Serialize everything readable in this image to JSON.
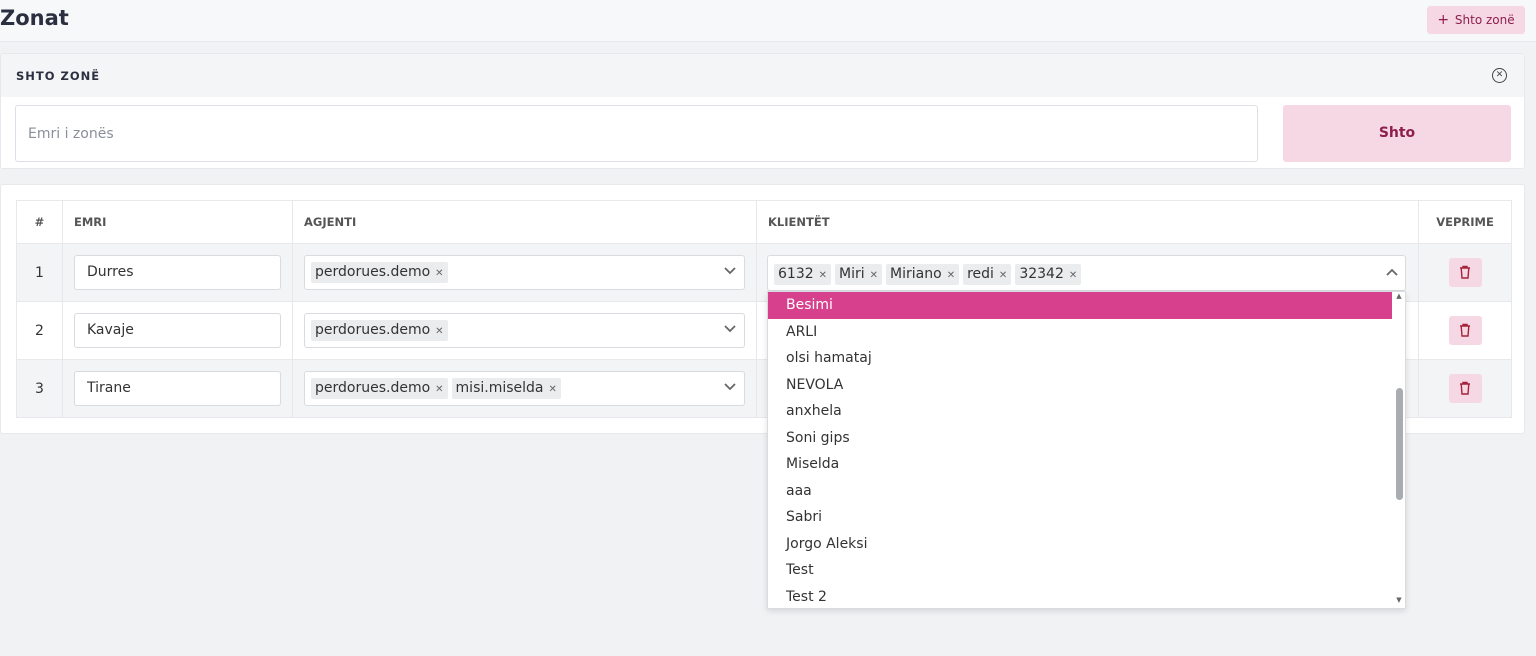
{
  "header": {
    "title": "Zonat",
    "add_button_label": "Shto zonë",
    "add_button_icon": "plus-icon"
  },
  "add_form": {
    "title": "SHTO ZONË",
    "name_placeholder": "Emri i zonës",
    "submit_label": "Shto",
    "close_icon": "close-circle-icon"
  },
  "table": {
    "columns": [
      "#",
      "EMRI",
      "AGJENTI",
      "KLIENTËT",
      "VEPRIME"
    ],
    "rows": [
      {
        "num": "1",
        "name": "Durres",
        "agents": [
          "perdorues.demo"
        ]
      },
      {
        "num": "2",
        "name": "Kavaje",
        "agents": [
          "perdorues.demo"
        ]
      },
      {
        "num": "3",
        "name": "Tirane",
        "agents": [
          "perdorues.demo",
          "misi.miselda"
        ]
      }
    ],
    "delete_icon": "trash-icon"
  },
  "client_select": {
    "selected": [
      "6132",
      "Miri",
      "Miriano",
      "redi",
      "32342"
    ],
    "options": [
      "Besimi",
      "ARLI",
      "olsi hamataj",
      "NEVOLA",
      "anxhela",
      "Soni gips",
      "Miselda",
      "aaa",
      "Sabri",
      "Jorgo Aleksi",
      "Test",
      "Test 2"
    ],
    "highlighted": "Besimi"
  },
  "colors": {
    "accent": "#d6408d",
    "button_bg": "#f6d7e4",
    "button_text": "#8d1f4f"
  }
}
